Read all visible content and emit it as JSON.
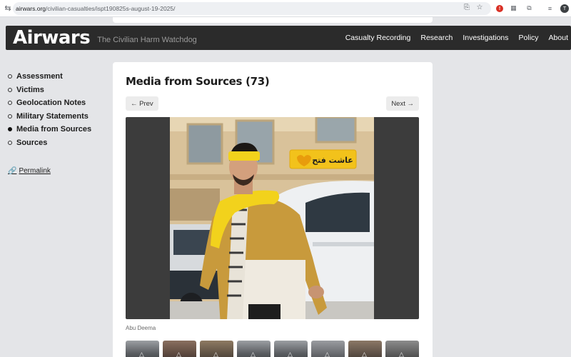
{
  "browser": {
    "url_host": "airwars.org",
    "url_path": "/civilian-casualties/ispt190825s-august-19-2025/",
    "avatar_letter": "T"
  },
  "header": {
    "logo": "Airwars",
    "tagline": "The Civilian Harm Watchdog",
    "nav": [
      "Casualty Recording",
      "Research",
      "Investigations",
      "Policy",
      "About"
    ]
  },
  "sidebar": {
    "items": [
      {
        "label": "Assessment",
        "active": false
      },
      {
        "label": "Victims",
        "active": false
      },
      {
        "label": "Geolocation Notes",
        "active": false
      },
      {
        "label": "Military Statements",
        "active": false
      },
      {
        "label": "Media from Sources",
        "active": true
      },
      {
        "label": "Sources",
        "active": false
      }
    ],
    "permalink": "Permalink"
  },
  "main": {
    "title": "Media from Sources (73)",
    "prev_label": "← Prev",
    "next_label": "Next →",
    "photo_banner_text": "عاشت فتح",
    "caption": "Abu Deema",
    "thumbnail_count": 8
  },
  "colors": {
    "header_bg": "#2b2b2b",
    "page_bg": "#e4e5e8",
    "banner_yellow": "#f2c21b"
  }
}
